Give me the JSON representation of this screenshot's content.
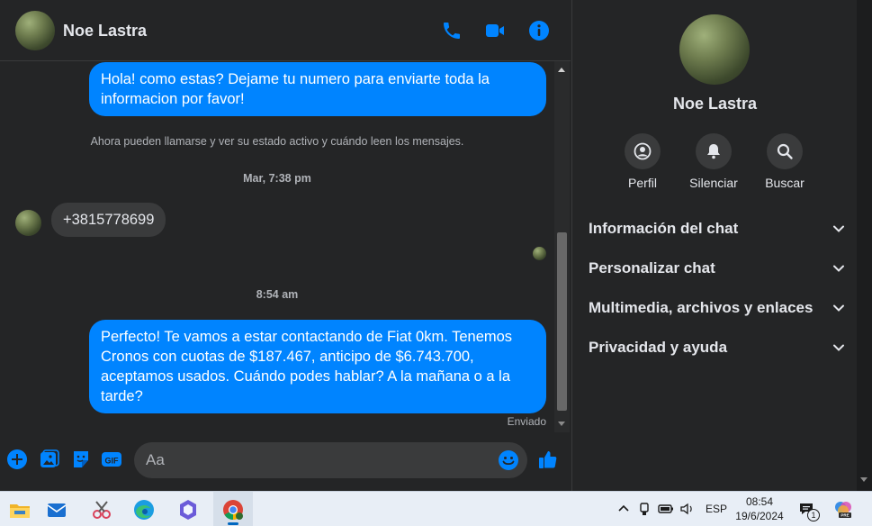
{
  "chat": {
    "contact_name": "Noe Lastra",
    "messages": {
      "out_1": "Hola! como estas? Dejame tu numero para enviarte toda la informacion por favor!",
      "system_notice": "Ahora pueden llamarse y ver su estado activo y cuándo leen los mensajes.",
      "time_1": "Mar, 7:38 pm",
      "in_1": "+3815778699",
      "time_2": "8:54 am",
      "out_2": "Perfecto! Te vamos a estar contactando de Fiat 0km. Tenemos Cronos con cuotas de $187.467, anticipo de $6.743.700, aceptamos usados. Cuándo podes hablar? A la mañana o a la tarde?",
      "status": "Enviado"
    },
    "composer": {
      "placeholder": "Aa"
    }
  },
  "info": {
    "name": "Noe Lastra",
    "actions": {
      "profile": "Perfil",
      "mute": "Silenciar",
      "search": "Buscar"
    },
    "sections": {
      "chat_info": "Información del chat",
      "customize": "Personalizar chat",
      "media": "Multimedia, archivos y enlaces",
      "privacy": "Privacidad y ayuda"
    }
  },
  "taskbar": {
    "language": "ESP",
    "time": "08:54",
    "date": "19/6/2024",
    "notification_count": "1"
  },
  "colors": {
    "accent": "#0084ff",
    "panel_bg": "#242526",
    "bubble_in": "#3a3b3c",
    "text": "#e4e6eb",
    "muted": "#b0b3b8"
  }
}
